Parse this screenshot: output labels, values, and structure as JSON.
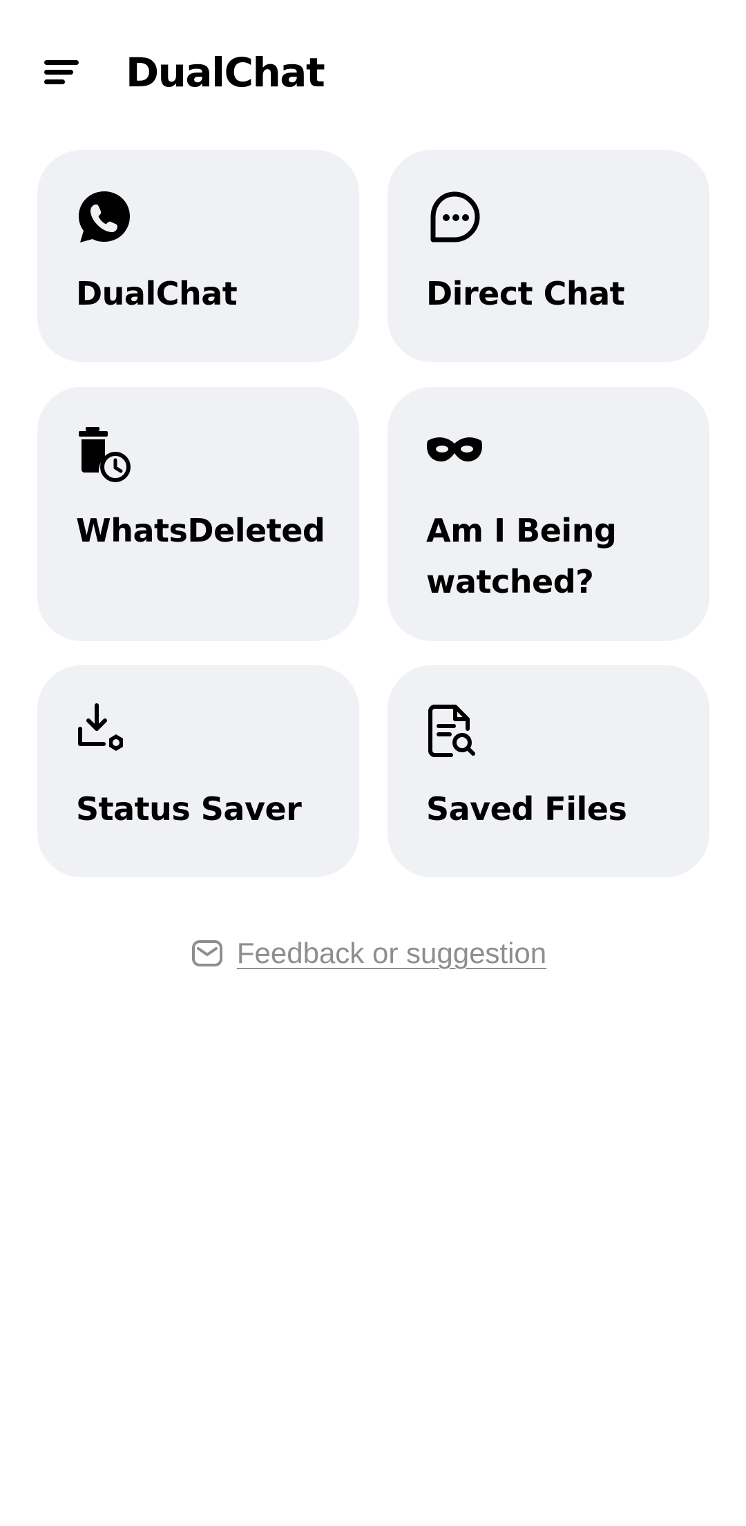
{
  "header": {
    "title": "DualChat",
    "menu_icon": "sort-menu-icon"
  },
  "cards": [
    {
      "label": "DualChat",
      "icon": "whatsapp-phone-icon"
    },
    {
      "label": "Direct Chat",
      "icon": "chat-bubble-dots-icon"
    },
    {
      "label": "WhatsDeleted",
      "icon": "trash-clock-icon"
    },
    {
      "label_line1": "Am I Being",
      "label_line2": "watched?",
      "icon": "mask-icon"
    },
    {
      "label": "Status Saver",
      "icon": "download-tray-icon"
    },
    {
      "label": "Saved Files",
      "icon": "document-search-icon"
    }
  ],
  "feedback": {
    "label": "Feedback or suggestion",
    "icon": "mail-icon"
  },
  "colors": {
    "card_background": "#f0f1f5",
    "text": "#000000",
    "link": "#8e8e8e"
  }
}
